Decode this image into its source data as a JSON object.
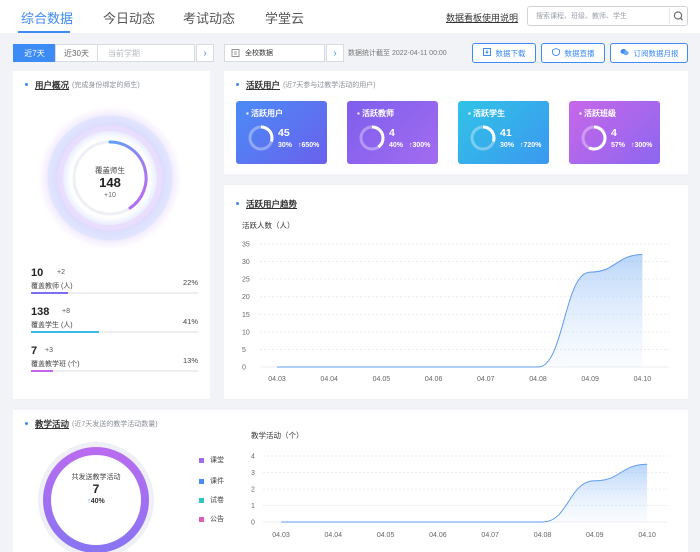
{
  "nav": {
    "tabs": [
      {
        "label": "综合数据",
        "active": true
      },
      {
        "label": "今日动态",
        "active": false
      },
      {
        "label": "考试动态",
        "active": false
      },
      {
        "label": "学堂云",
        "active": false
      }
    ],
    "help_link": "数据看板使用说明",
    "search_placeholder": "搜索课程、班级、教师、学生",
    "search_icon": "search-icon"
  },
  "filters": {
    "range_options": [
      {
        "label": "近7天",
        "active": true
      },
      {
        "label": "近30天",
        "active": false
      },
      {
        "label": "当前学期",
        "active": false,
        "disabled": true
      }
    ],
    "scope": "全校数据",
    "scope_icon": "building-icon",
    "stat_date": "数据统计截至 2022-04-11 00:00",
    "actions": [
      {
        "label": "数据下载",
        "icon": "download-icon"
      },
      {
        "label": "数据直播",
        "icon": "live-icon"
      },
      {
        "label": "订阅数据月报",
        "icon": "subscribe-icon"
      }
    ]
  },
  "user_overview": {
    "title": "用户概况",
    "subtitle": "(完成身份绑定的师生)",
    "ring_label": "覆盖师生",
    "total": "148",
    "increase": "10",
    "stats": [
      {
        "num": "10",
        "inc": "2",
        "label": "覆盖教师 (人)",
        "pct": "22%",
        "fill": 0.22,
        "color": "#7b6ef0"
      },
      {
        "num": "138",
        "inc": "8",
        "label": "覆盖学生 (人)",
        "pct": "41%",
        "fill": 0.41,
        "color": "#38b9e6"
      },
      {
        "num": "7",
        "inc": "3",
        "label": "覆盖教学班 (个)",
        "pct": "13%",
        "fill": 0.13,
        "color": "#c665ea"
      }
    ]
  },
  "active_users": {
    "title": "活跃用户",
    "subtitle": "(近7天参与过教学活动的用户)",
    "cards": [
      {
        "title": "活跃用户",
        "value": "45",
        "pct": "30%",
        "inc": "650%",
        "ratio": 0.3,
        "c1": "#4a8cf6",
        "c2": "#6a60ec"
      },
      {
        "title": "活跃教师",
        "value": "4",
        "pct": "40%",
        "inc": "300%",
        "ratio": 0.4,
        "c1": "#7d5eec",
        "c2": "#a36cf0"
      },
      {
        "title": "活跃学生",
        "value": "41",
        "pct": "30%",
        "inc": "720%",
        "ratio": 0.3,
        "c1": "#31c3e6",
        "c2": "#3b98f0"
      },
      {
        "title": "活跃班级",
        "value": "4",
        "pct": "57%",
        "inc": "300%",
        "ratio": 0.57,
        "c1": "#c767e8",
        "c2": "#8c67f0"
      }
    ]
  },
  "trend": {
    "title": "活跃用户趋势",
    "axis_title": "活跃人数（人）"
  },
  "teaching": {
    "title": "教学活动",
    "subtitle": "(近7天发送的教学活动数量)",
    "ring_label": "共发送教学活动",
    "total": "7",
    "inc": "40%",
    "legend": [
      {
        "label": "课堂",
        "color": "#9b6cf0"
      },
      {
        "label": "课件",
        "color": "#4a8cf6"
      },
      {
        "label": "试卷",
        "color": "#2fc4c0"
      },
      {
        "label": "公告",
        "color": "#e05db5"
      }
    ],
    "axis_title": "教学活动（个）"
  },
  "chart_data": [
    {
      "type": "area",
      "title": "活跃用户趋势",
      "ylabel": "活跃人数（人）",
      "x": [
        "04.03",
        "04.04",
        "04.05",
        "04.06",
        "04.07",
        "04.08",
        "04.09",
        "04.10"
      ],
      "values": [
        0,
        0,
        0,
        0,
        0,
        0,
        27,
        32
      ],
      "ylim": [
        0,
        35
      ],
      "yticks": [
        0,
        5,
        10,
        15,
        20,
        25,
        30,
        35
      ]
    },
    {
      "type": "area",
      "title": "教学活动",
      "ylabel": "教学活动（个）",
      "x": [
        "04.03",
        "04.04",
        "04.05",
        "04.06",
        "04.07",
        "04.08",
        "04.09",
        "04.10"
      ],
      "values": [
        0,
        0,
        0,
        0,
        0,
        0,
        2.5,
        3.5
      ],
      "ylim": [
        0,
        4
      ],
      "yticks": [
        0,
        1,
        2,
        3,
        4
      ]
    }
  ]
}
